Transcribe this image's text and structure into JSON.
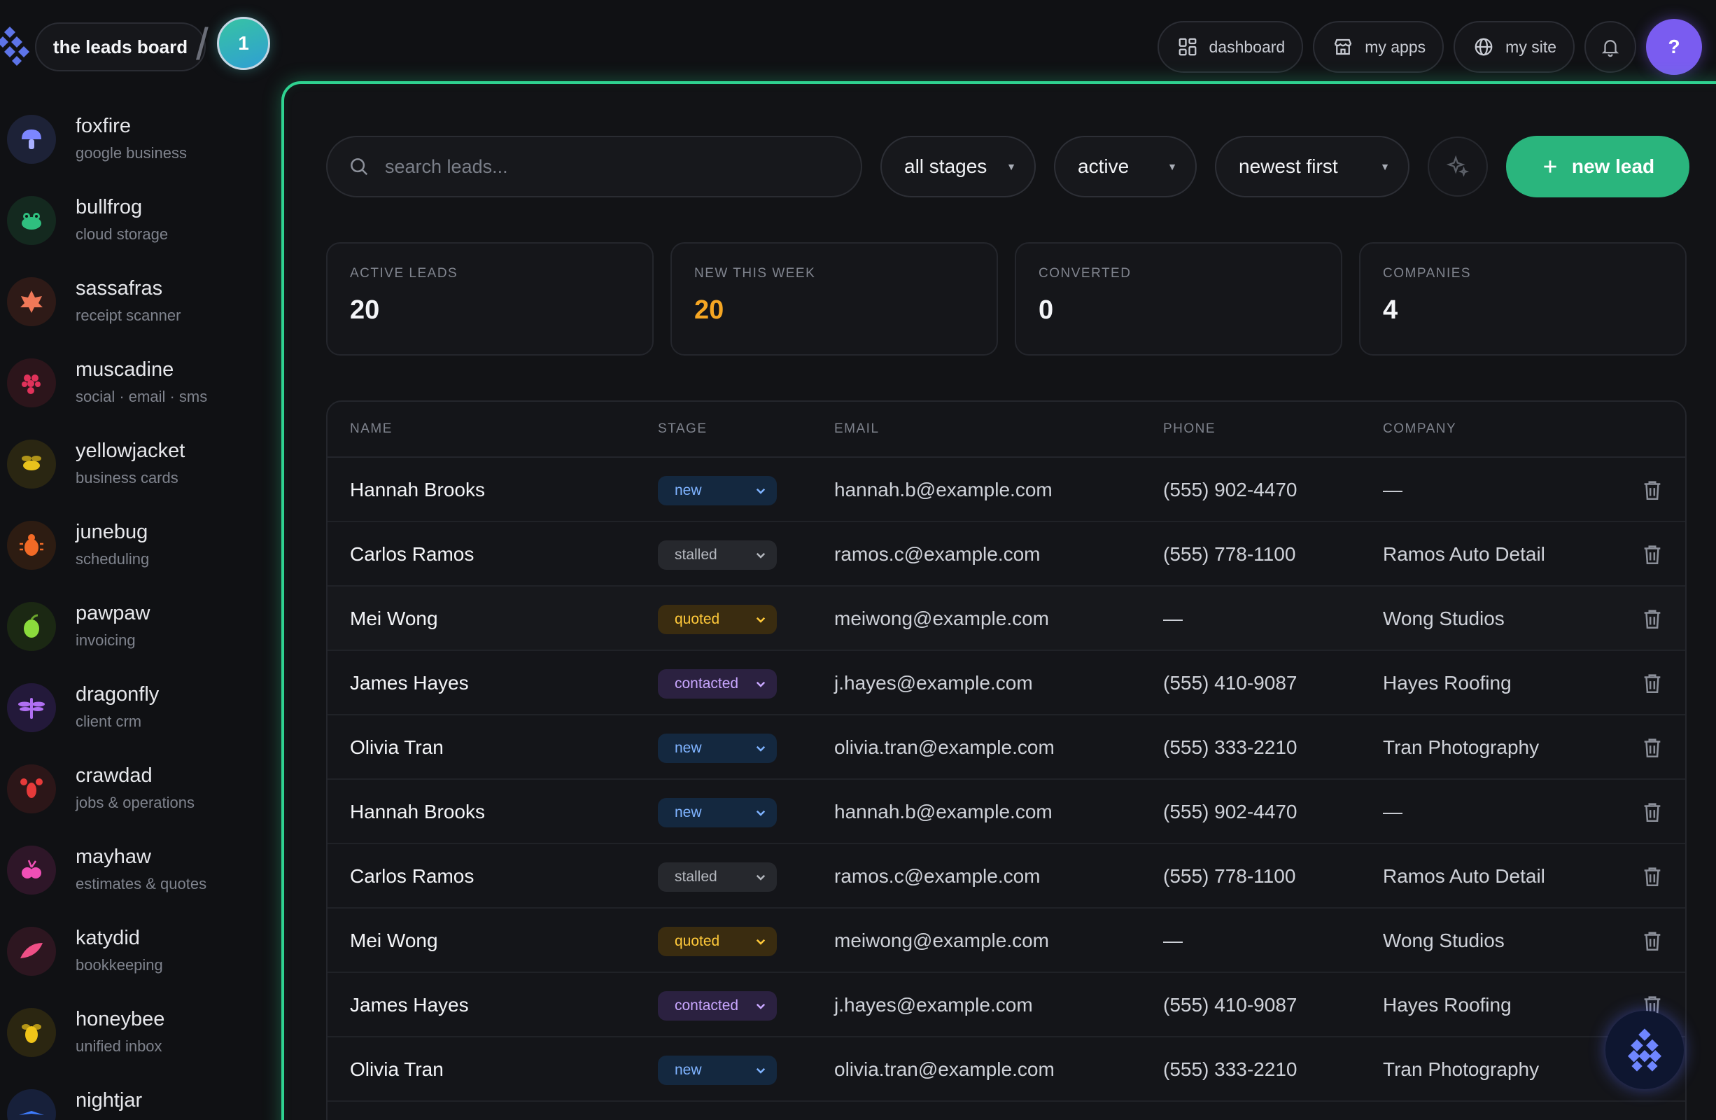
{
  "header": {
    "brand_label": "the leads board",
    "step_number": "1",
    "nav": [
      {
        "label": "dashboard",
        "icon": "grid-icon"
      },
      {
        "label": "my apps",
        "icon": "store-icon"
      },
      {
        "label": "my site",
        "icon": "globe-icon"
      }
    ],
    "help_label": "?"
  },
  "sidebar": {
    "items": [
      {
        "name": "foxfire",
        "sub": "google business",
        "icon": "mushroom-icon",
        "color": "#7c86ff",
        "bg": "#1d2237"
      },
      {
        "name": "bullfrog",
        "sub": "cloud storage",
        "icon": "frog-icon",
        "color": "#2fbf7f",
        "bg": "#14291f"
      },
      {
        "name": "sassafras",
        "sub": "receipt scanner",
        "icon": "leaf-icon",
        "color": "#f07858",
        "bg": "#2e1a17"
      },
      {
        "name": "muscadine",
        "sub": "social · email · sms",
        "icon": "grapes-icon",
        "color": "#e0325a",
        "bg": "#2c151b"
      },
      {
        "name": "yellowjacket",
        "sub": "business cards",
        "icon": "wasp-icon",
        "color": "#e8c21c",
        "bg": "#2a2612"
      },
      {
        "name": "junebug",
        "sub": "scheduling",
        "icon": "bug-icon",
        "color": "#f26a26",
        "bg": "#2d1c12"
      },
      {
        "name": "pawpaw",
        "sub": "invoicing",
        "icon": "fruit-icon",
        "color": "#8bdc3c",
        "bg": "#1b2813"
      },
      {
        "name": "dragonfly",
        "sub": "client crm",
        "icon": "dragonfly-icon",
        "color": "#b06ff2",
        "bg": "#23193a"
      },
      {
        "name": "crawdad",
        "sub": "jobs & operations",
        "icon": "crawfish-icon",
        "color": "#e63a3a",
        "bg": "#2c1618"
      },
      {
        "name": "mayhaw",
        "sub": "estimates & quotes",
        "icon": "berry-icon",
        "color": "#f04fb6",
        "bg": "#2e1628"
      },
      {
        "name": "katydid",
        "sub": "bookkeeping",
        "icon": "katydid-icon",
        "color": "#ef4f86",
        "bg": "#2d1620"
      },
      {
        "name": "honeybee",
        "sub": "unified inbox",
        "icon": "bee-icon",
        "color": "#f0c419",
        "bg": "#2b2611"
      },
      {
        "name": "nightjar",
        "sub": "",
        "icon": "bird-icon",
        "color": "#3f7dff",
        "bg": "#17203a"
      }
    ]
  },
  "toolbar": {
    "search_placeholder": "search leads...",
    "stage_filter": "all stages",
    "status_filter": "active",
    "sort": "newest first",
    "new_lead_label": "new lead"
  },
  "stats": [
    {
      "label": "ACTIVE LEADS",
      "value": "20",
      "color": "#f4f5f8"
    },
    {
      "label": "NEW THIS WEEK",
      "value": "20",
      "color": "#f5a623"
    },
    {
      "label": "CONVERTED",
      "value": "0",
      "color": "#f4f5f8"
    },
    {
      "label": "COMPANIES",
      "value": "4",
      "color": "#f4f5f8"
    }
  ],
  "table": {
    "columns": [
      "NAME",
      "STAGE",
      "EMAIL",
      "PHONE",
      "COMPANY"
    ],
    "rows": [
      {
        "name": "Hannah Brooks",
        "stage": "new",
        "email": "hannah.b@example.com",
        "phone": "(555) 902-4470",
        "company": "—"
      },
      {
        "name": "Carlos Ramos",
        "stage": "stalled",
        "email": "ramos.c@example.com",
        "phone": "(555) 778-1100",
        "company": "Ramos Auto Detail"
      },
      {
        "name": "Mei Wong",
        "stage": "quoted",
        "email": "meiwong@example.com",
        "phone": "—",
        "company": "Wong Studios"
      },
      {
        "name": "James Hayes",
        "stage": "contacted",
        "email": "j.hayes@example.com",
        "phone": "(555) 410-9087",
        "company": "Hayes Roofing"
      },
      {
        "name": "Olivia Tran",
        "stage": "new",
        "email": "olivia.tran@example.com",
        "phone": "(555) 333-2210",
        "company": "Tran Photography"
      },
      {
        "name": "Hannah Brooks",
        "stage": "new",
        "email": "hannah.b@example.com",
        "phone": "(555) 902-4470",
        "company": "—"
      },
      {
        "name": "Carlos Ramos",
        "stage": "stalled",
        "email": "ramos.c@example.com",
        "phone": "(555) 778-1100",
        "company": "Ramos Auto Detail"
      },
      {
        "name": "Mei Wong",
        "stage": "quoted",
        "email": "meiwong@example.com",
        "phone": "—",
        "company": "Wong Studios"
      },
      {
        "name": "James Hayes",
        "stage": "contacted",
        "email": "j.hayes@example.com",
        "phone": "(555) 410-9087",
        "company": "Hayes Roofing"
      },
      {
        "name": "Olivia Tran",
        "stage": "new",
        "email": "olivia.tran@example.com",
        "phone": "(555) 333-2210",
        "company": "Tran Photography"
      }
    ]
  },
  "colors": {
    "accent": "#2fd391",
    "primary_button": "#2ab57d",
    "help_button": "#7a5cf0"
  }
}
